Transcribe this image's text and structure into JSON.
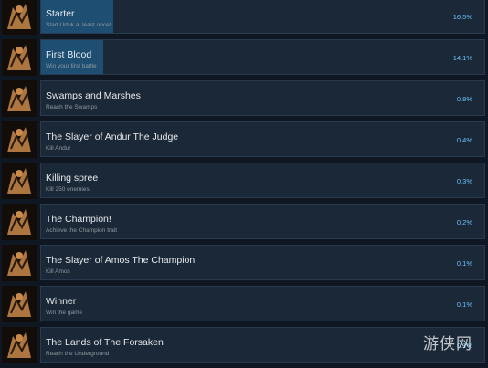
{
  "achievements": [
    {
      "title": "Starter",
      "description": "Start Urtuk at least once!",
      "percent": "16.5%",
      "fill": 16.5
    },
    {
      "title": "First Blood",
      "description": "Win your first battle",
      "percent": "14.1%",
      "fill": 14.1
    },
    {
      "title": "Swamps and Marshes",
      "description": "Reach the Swamps",
      "percent": "0.8%",
      "fill": 0.8
    },
    {
      "title": "The Slayer of Andur The Judge",
      "description": "Kill Andur",
      "percent": "0.4%",
      "fill": 0.4
    },
    {
      "title": "Killing spree",
      "description": "Kill 250 enemies",
      "percent": "0.3%",
      "fill": 0.3
    },
    {
      "title": "The Champion!",
      "description": "Achieve the Champion trait",
      "percent": "0.2%",
      "fill": 0.2
    },
    {
      "title": "The Slayer of Amos The Champion",
      "description": "Kill Amos",
      "percent": "0.1%",
      "fill": 0.1
    },
    {
      "title": "Winner",
      "description": "Win the game",
      "percent": "0.1%",
      "fill": 0.1
    },
    {
      "title": "The Lands of The Forsaken",
      "description": "Reach the Underground",
      "percent": "0.1%",
      "fill": 0.1
    }
  ],
  "watermark": "游侠网",
  "colors": {
    "bar": "#1b2838",
    "fill": "#1e4e72",
    "percent": "#67c1f5",
    "icon_art": "#c98a4a"
  }
}
